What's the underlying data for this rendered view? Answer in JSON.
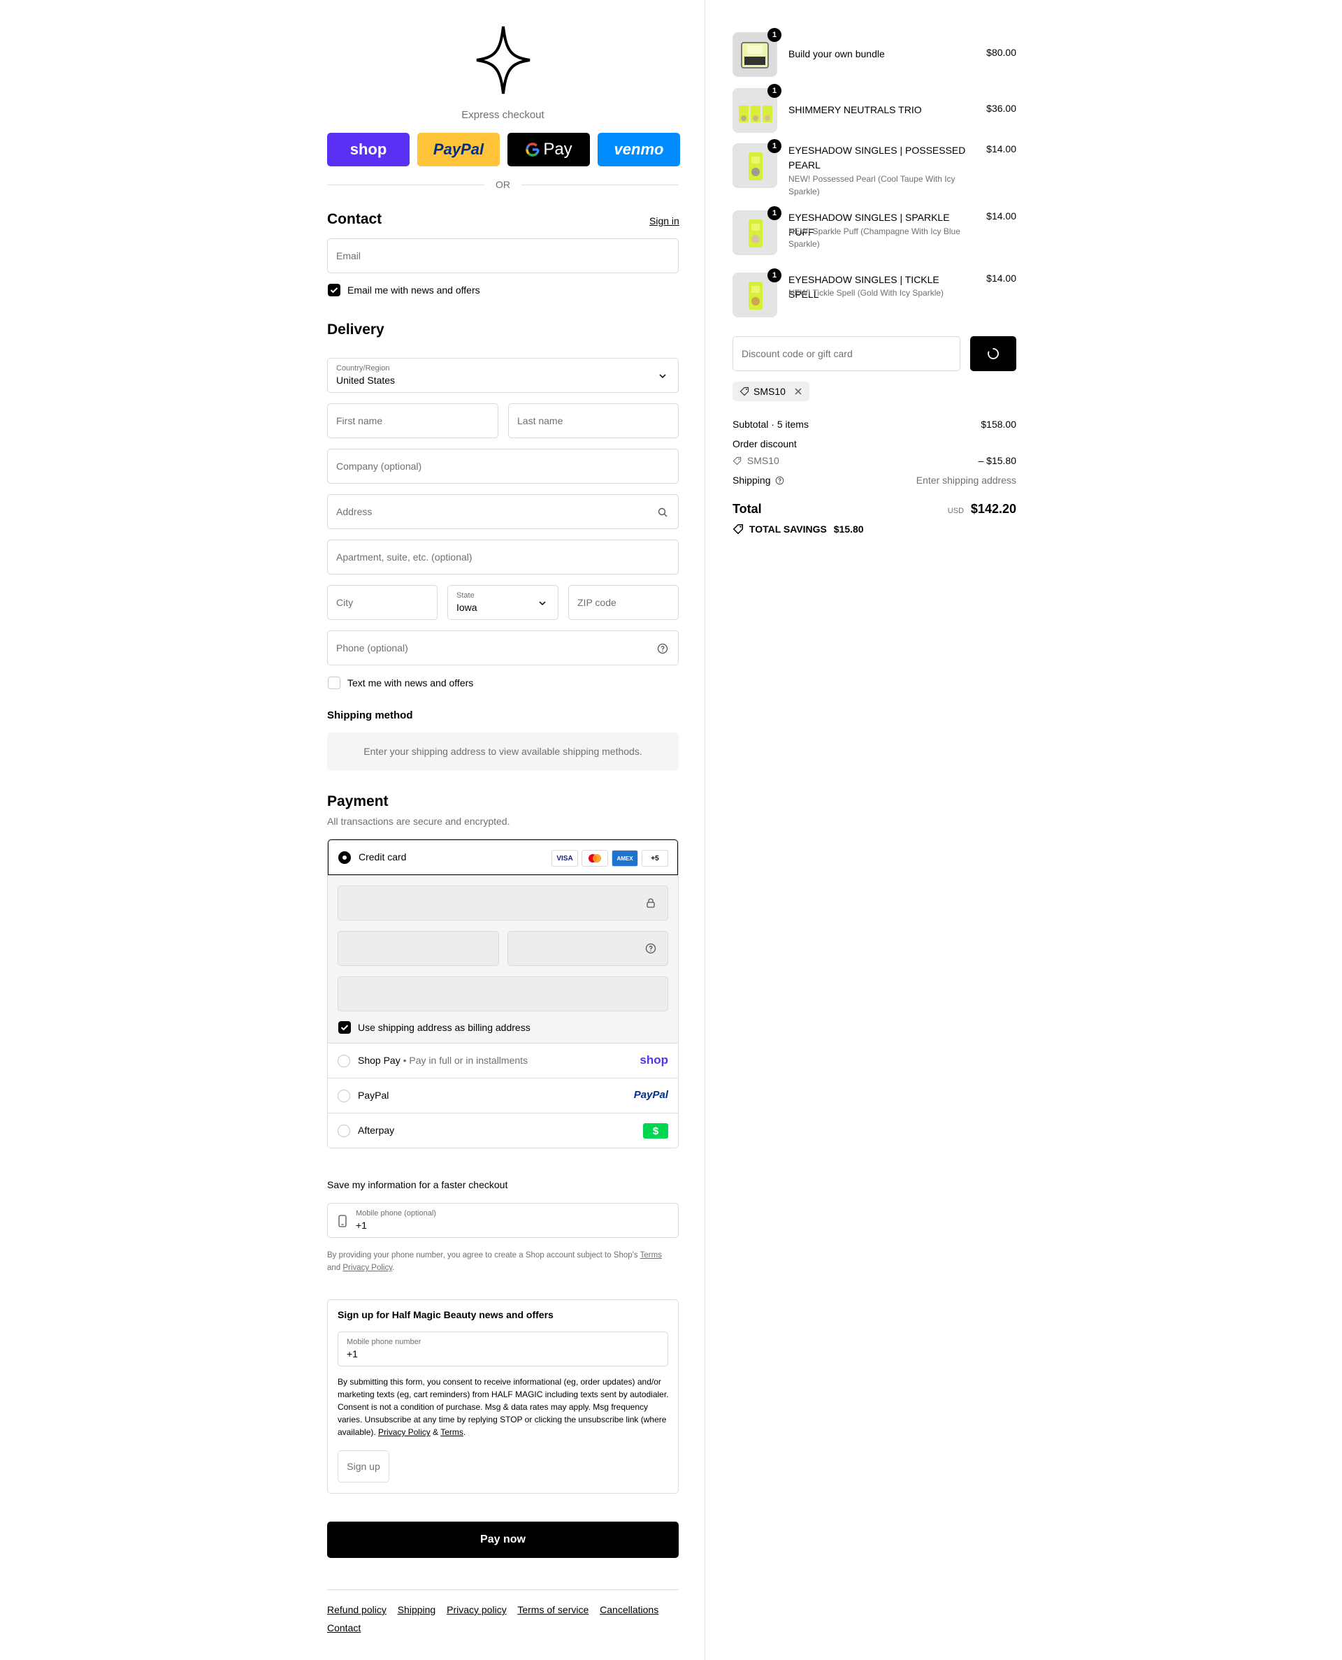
{
  "express": {
    "label": "Express checkout",
    "buttons": [
      {
        "name": "shop-pay",
        "label": "shop",
        "bg": "#5a31f4",
        "fg": "#ffffff"
      },
      {
        "name": "paypal",
        "label": "PayPal",
        "bg": "#ffc439",
        "fg": "#003087"
      },
      {
        "name": "google-pay",
        "label": "Pay",
        "bg": "#000000",
        "fg": "#ffffff"
      },
      {
        "name": "venmo",
        "label": "venmo",
        "bg": "#008cff",
        "fg": "#ffffff"
      }
    ],
    "or": "OR"
  },
  "contact": {
    "title": "Contact",
    "sign_in": "Sign in",
    "email_placeholder": "Email",
    "news_label": "Email me with news and offers"
  },
  "delivery": {
    "title": "Delivery",
    "country_label": "Country/Region",
    "country_value": "United States",
    "first_name": "First name",
    "last_name": "Last name",
    "company": "Company (optional)",
    "address": "Address",
    "apartment": "Apartment, suite, etc. (optional)",
    "city": "City",
    "state_label": "State",
    "state_value": "Iowa",
    "zip": "ZIP code",
    "phone": "Phone (optional)",
    "text_label": "Text me with news and offers"
  },
  "shipping_method": {
    "title": "Shipping method",
    "message": "Enter your shipping address to view available shipping methods."
  },
  "payment": {
    "title": "Payment",
    "subtitle": "All transactions are secure and encrypted.",
    "credit_card": "Credit card",
    "card_more": "+5",
    "billing_label": "Use shipping address as billing address",
    "shop_pay": "Shop Pay",
    "shop_pay_sub": "Pay in full or in installments",
    "shop_pay_logo": "shop",
    "paypal": "PayPal",
    "paypal_logo": "PayPal",
    "afterpay": "Afterpay",
    "afterpay_logo": "$"
  },
  "save_info": {
    "title": "Save my information for a faster checkout",
    "phone_label": "Mobile phone (optional)",
    "phone_value": "+1",
    "disclaimer_pre": "By providing your phone number, you agree to create a Shop account subject to Shop's",
    "terms": "Terms",
    "and": "and",
    "privacy": "Privacy Policy",
    "period": "."
  },
  "signup": {
    "title": "Sign up for Half Magic Beauty news and offers",
    "phone_label": "Mobile phone number",
    "phone_value": "+1",
    "consent": "By submitting this form, you consent to receive informational (eg, order updates) and/or marketing texts (eg, cart reminders) from HALF MAGIC including texts sent by autodialer. Consent is not a condition of purchase. Msg & data rates may apply. Msg frequency varies. Unsubscribe at any time by replying STOP or clicking the unsubscribe link (where available).",
    "privacy": "Privacy Policy",
    "amp": "&",
    "terms": "Terms",
    "period": ".",
    "button": "Sign up"
  },
  "pay_now": "Pay now",
  "footer": {
    "links": [
      "Refund policy",
      "Shipping",
      "Privacy policy",
      "Terms of service",
      "Cancellations",
      "Contact"
    ]
  },
  "cart": {
    "items": [
      {
        "qty": "1",
        "name": "Build your own bundle",
        "sub": "",
        "price": "$80.00"
      },
      {
        "qty": "1",
        "name": "SHIMMERY NEUTRALS TRIO",
        "sub": "",
        "price": "$36.00"
      },
      {
        "qty": "1",
        "name": "EYESHADOW SINGLES | POSSESSED PEARL",
        "sub": "NEW! Possessed Pearl (Cool Taupe With Icy Sparkle)",
        "price": "$14.00"
      },
      {
        "qty": "1",
        "name": "EYESHADOW SINGLES | SPARKLE PUFF",
        "sub": "NEW! Sparkle Puff (Champagne With Icy Blue Sparkle)",
        "price": "$14.00"
      },
      {
        "qty": "1",
        "name": "EYESHADOW SINGLES | TICKLE SPELL",
        "sub": "NEW! Tickle Spell (Gold With Icy Sparkle)",
        "price": "$14.00"
      }
    ],
    "discount_placeholder": "Discount code or gift card",
    "applied_code": "SMS10",
    "subtotal_label": "Subtotal · 5 items",
    "subtotal_value": "$158.00",
    "order_discount_label": "Order discount",
    "discount_code": "SMS10",
    "discount_value": "– $15.80",
    "shipping_label": "Shipping",
    "shipping_value": "Enter shipping address",
    "total_label": "Total",
    "currency": "USD",
    "total_value": "$142.20",
    "savings_label": "TOTAL SAVINGS",
    "savings_value": "$15.80"
  }
}
